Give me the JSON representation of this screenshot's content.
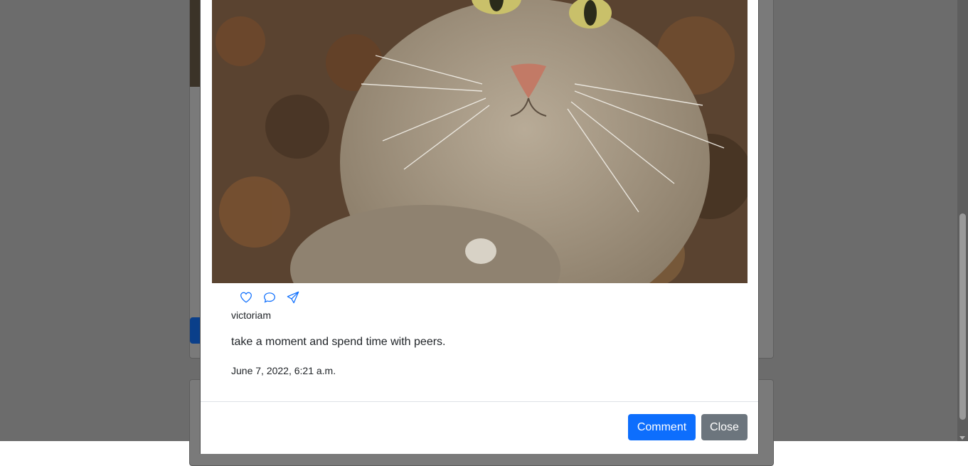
{
  "post": {
    "author": "victoriam",
    "caption": "take a moment and spend time with peers.",
    "timestamp": "June 7, 2022, 6:21 a.m.",
    "image_alt": "cat-photo"
  },
  "actions": [
    {
      "icon": "heart-icon"
    },
    {
      "icon": "chat-bubble-icon"
    },
    {
      "icon": "send-icon"
    }
  ],
  "footer": {
    "comment_label": "Comment",
    "close_label": "Close"
  },
  "colors": {
    "primary": "#0d6efd",
    "secondary": "#6c757d",
    "icon": "#0d6efd"
  }
}
